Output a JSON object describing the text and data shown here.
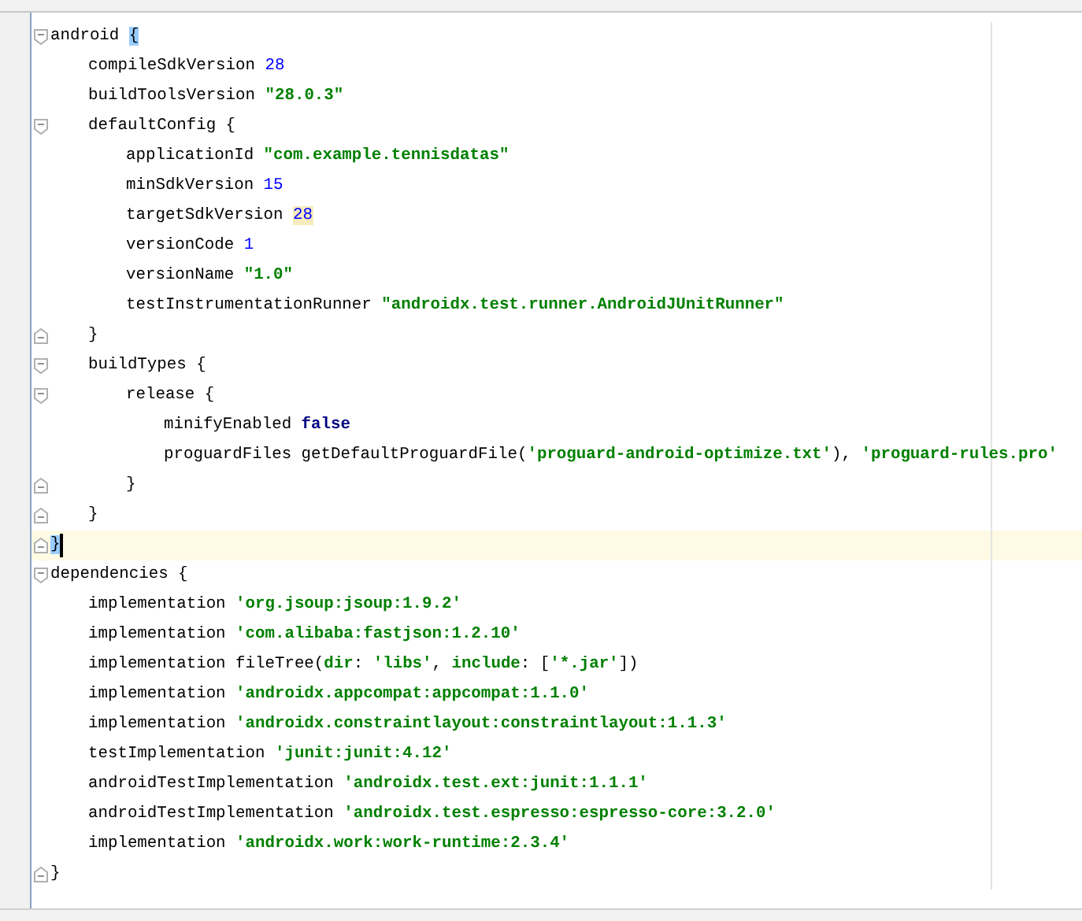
{
  "editor": {
    "lines": [
      {
        "tokens": [
          {
            "kind": "plain",
            "text": "android "
          },
          {
            "kind": "plain",
            "text": "{",
            "matched": true
          }
        ],
        "closing": {
          "tokens": [
            {
              "kind": "plain",
              "text": "}",
              "matched": true
            }
          ],
          "current": true
        },
        "children": [
          {
            "tokens": [
              {
                "kind": "plain",
                "text": "compileSdkVersion "
              },
              {
                "kind": "number",
                "text": "28"
              }
            ]
          },
          {
            "tokens": [
              {
                "kind": "plain",
                "text": "buildToolsVersion "
              },
              {
                "kind": "string",
                "text": "\"28.0.3\""
              }
            ]
          },
          {
            "tokens": [
              {
                "kind": "plain",
                "text": "defaultConfig {"
              }
            ],
            "closing": {
              "tokens": [
                {
                  "kind": "plain",
                  "text": "}"
                }
              ],
              "current": false
            },
            "children": [
              {
                "tokens": [
                  {
                    "kind": "plain",
                    "text": "applicationId "
                  },
                  {
                    "kind": "string",
                    "text": "\"com.example.tennisdatas\""
                  }
                ]
              },
              {
                "tokens": [
                  {
                    "kind": "plain",
                    "text": "minSdkVersion "
                  },
                  {
                    "kind": "number",
                    "text": "15"
                  }
                ]
              },
              {
                "tokens": [
                  {
                    "kind": "plain",
                    "text": "targetSdkVersion "
                  },
                  {
                    "kind": "number",
                    "text": "28",
                    "warned": true
                  }
                ]
              },
              {
                "tokens": [
                  {
                    "kind": "plain",
                    "text": "versionCode "
                  },
                  {
                    "kind": "number",
                    "text": "1"
                  }
                ]
              },
              {
                "tokens": [
                  {
                    "kind": "plain",
                    "text": "versionName "
                  },
                  {
                    "kind": "string",
                    "text": "\"1.0\""
                  }
                ]
              },
              {
                "tokens": [
                  {
                    "kind": "plain",
                    "text": "testInstrumentationRunner "
                  },
                  {
                    "kind": "string",
                    "text": "\"androidx.test.runner.AndroidJUnitRunner\""
                  }
                ]
              }
            ]
          },
          {
            "tokens": [
              {
                "kind": "plain",
                "text": "buildTypes {"
              }
            ],
            "closing": {
              "tokens": [
                {
                  "kind": "plain",
                  "text": "}"
                }
              ],
              "current": false
            },
            "children": [
              {
                "tokens": [
                  {
                    "kind": "plain",
                    "text": "release {"
                  }
                ],
                "closing": {
                  "tokens": [
                    {
                      "kind": "plain",
                      "text": "}"
                    }
                  ],
                  "current": false
                },
                "children": [
                  {
                    "tokens": [
                      {
                        "kind": "plain",
                        "text": "minifyEnabled "
                      },
                      {
                        "kind": "keyword",
                        "text": "false"
                      }
                    ]
                  },
                  {
                    "tokens": [
                      {
                        "kind": "plain",
                        "text": "proguardFiles getDefaultProguardFile("
                      },
                      {
                        "kind": "string",
                        "text": "'proguard-android-optimize.txt'"
                      },
                      {
                        "kind": "plain",
                        "text": "), "
                      },
                      {
                        "kind": "string",
                        "text": "'proguard-rules.pro'"
                      }
                    ]
                  }
                ]
              }
            ]
          }
        ]
      },
      {
        "tokens": [
          {
            "kind": "plain",
            "text": "dependencies {"
          }
        ],
        "closing": {
          "tokens": [
            {
              "kind": "plain",
              "text": "}"
            }
          ],
          "current": false
        },
        "children": [
          {
            "tokens": [
              {
                "kind": "plain",
                "text": "implementation "
              },
              {
                "kind": "string",
                "text": "'org.jsoup:jsoup:1.9.2'"
              }
            ]
          },
          {
            "tokens": [
              {
                "kind": "plain",
                "text": "implementation "
              },
              {
                "kind": "string",
                "text": "'com.alibaba:fastjson:1.2.10'"
              }
            ]
          },
          {
            "tokens": [
              {
                "kind": "plain",
                "text": "implementation fileTree("
              },
              {
                "kind": "string",
                "text": "dir"
              },
              {
                "kind": "plain",
                "text": ": "
              },
              {
                "kind": "string",
                "text": "'libs'"
              },
              {
                "kind": "plain",
                "text": ", "
              },
              {
                "kind": "string",
                "text": "include"
              },
              {
                "kind": "plain",
                "text": ": ["
              },
              {
                "kind": "string",
                "text": "'*.jar'"
              },
              {
                "kind": "plain",
                "text": "])"
              }
            ]
          },
          {
            "tokens": [
              {
                "kind": "plain",
                "text": "implementation "
              },
              {
                "kind": "string",
                "text": "'androidx.appcompat:appcompat:1.1.0'"
              }
            ]
          },
          {
            "tokens": [
              {
                "kind": "plain",
                "text": "implementation "
              },
              {
                "kind": "string",
                "text": "'androidx.constraintlayout:constraintlayout:1.1.3'"
              }
            ]
          },
          {
            "tokens": [
              {
                "kind": "plain",
                "text": "testImplementation "
              },
              {
                "kind": "string",
                "text": "'junit:junit:4.12'"
              }
            ]
          },
          {
            "tokens": [
              {
                "kind": "plain",
                "text": "androidTestImplementation "
              },
              {
                "kind": "string",
                "text": "'androidx.test.ext:junit:1.1.1'"
              }
            ]
          },
          {
            "tokens": [
              {
                "kind": "plain",
                "text": "androidTestImplementation "
              },
              {
                "kind": "string",
                "text": "'androidx.test.espresso:espresso-core:3.2.0'"
              }
            ]
          },
          {
            "tokens": [
              {
                "kind": "plain",
                "text": "implementation "
              },
              {
                "kind": "string",
                "text": "'androidx.work:work-runtime:2.3.4'"
              }
            ]
          }
        ]
      }
    ]
  }
}
